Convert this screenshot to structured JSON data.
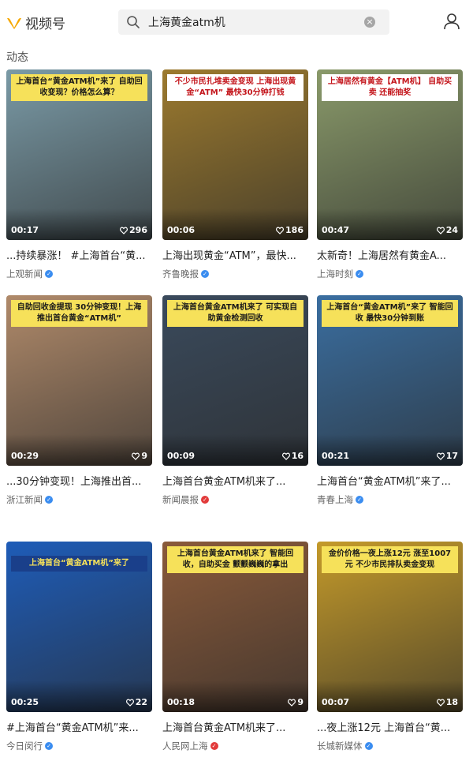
{
  "header": {
    "app_name": "视频号",
    "search_value": "上海黄金atm机",
    "section_label": "动态"
  },
  "colors": {
    "accent": "#f6a800",
    "verified_blue": "#3b8df0",
    "verified_red": "#e23b3b"
  },
  "videos": [
    {
      "caption": "上海首台“黄金ATM机”来了 自助回收变现？价格怎么算？",
      "duration": "00:17",
      "likes": "296",
      "title": "...持续暴涨！ #上海首台“黄...",
      "author": "上观新闻",
      "badge": "blue",
      "bg": "#7a9aa6",
      "capbg": "#f6e15a"
    },
    {
      "caption": "不少市民扎堆卖金变现 上海出现黄金“ATM” 最快30分钟打钱",
      "duration": "00:06",
      "likes": "186",
      "title": "上海出现黄金“ATM”，最快...",
      "author": "齐鲁晚报",
      "badge": "blue",
      "bg": "#9c7a2e",
      "capbg": "#ffffff"
    },
    {
      "caption": "上海居然有黄金【ATM机】 自助买卖 还能抽奖",
      "duration": "00:47",
      "likes": "24",
      "title": "太新奇！上海居然有黄金A...",
      "author": "上海时刻",
      "badge": "blue",
      "bg": "#8a9a6a",
      "capbg": "#ffffff"
    },
    {
      "caption": "自助回收金提现 30分钟变现！上海推出首台黄金“ATM机”",
      "duration": "00:29",
      "likes": "9",
      "title": "...30分钟变现！上海推出首...",
      "author": "浙江新闻",
      "badge": "blue",
      "bg": "#b08a6a",
      "capbg": "#f6e15a"
    },
    {
      "caption": "上海首台黄金ATM机来了 可实现自助黄金检测回收",
      "duration": "00:09",
      "likes": "16",
      "title": "上海首台黄金ATM机来了...",
      "author": "新闻晨报",
      "badge": "red",
      "bg": "#3a4a5c",
      "capbg": "#f6e15a"
    },
    {
      "caption": "上海首台“黄金ATM机”来了 智能回收 最快30分钟到账",
      "duration": "00:21",
      "likes": "17",
      "title": "上海首台“黄金ATM机”来了...",
      "author": "青春上海",
      "badge": "blue",
      "bg": "#3a6ea0",
      "capbg": "#f6e15a"
    },
    {
      "caption": "上海首台“黄金ATM机”来了",
      "duration": "00:25",
      "likes": "22",
      "title": "#上海首台“黄金ATM机”来...",
      "author": "今日闵行",
      "badge": "blue",
      "bg": "#1e5cb8",
      "capbg": "#1a3f8a"
    },
    {
      "caption": "上海首台黄金ATM机来了 智能回收，自助买金 颤颤巍巍的拿出",
      "duration": "00:18",
      "likes": "9",
      "title": "上海首台黄金ATM机来了...",
      "author": "人民网上海",
      "badge": "red",
      "bg": "#8a5a3a",
      "capbg": "#f6e15a"
    },
    {
      "caption": "金价价格一夜上涨12元 涨至1007元 不少市民排队卖金变现",
      "duration": "00:07",
      "likes": "18",
      "title": "...夜上涨12元 上海首台“黄...",
      "author": "长城新媒体",
      "badge": "blue",
      "bg": "#c49a2a",
      "capbg": "#f6e15a"
    }
  ]
}
